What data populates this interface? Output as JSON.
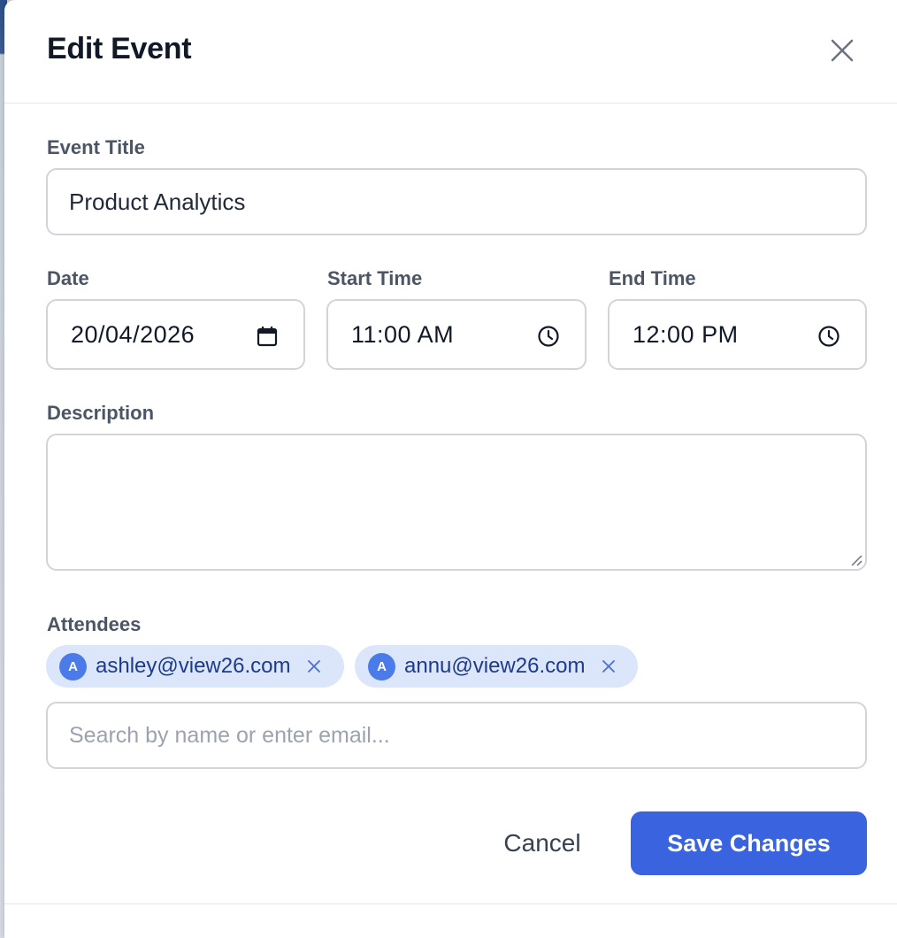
{
  "modal": {
    "title": "Edit Event",
    "close_icon": "close-icon"
  },
  "form": {
    "event_title": {
      "label": "Event Title",
      "value": "Product Analytics"
    },
    "date": {
      "label": "Date",
      "value": "20/04/2026",
      "icon": "calendar-icon"
    },
    "start_time": {
      "label": "Start Time",
      "value": "11:00 AM",
      "icon": "clock-icon"
    },
    "end_time": {
      "label": "End Time",
      "value": "12:00 PM",
      "icon": "clock-icon"
    },
    "description": {
      "label": "Description",
      "value": ""
    },
    "attendees": {
      "label": "Attendees",
      "items": [
        {
          "initial": "A",
          "email": "ashley@view26.com"
        },
        {
          "initial": "A",
          "email": "annu@view26.com"
        }
      ],
      "search_placeholder": "Search by name or enter email..."
    }
  },
  "actions": {
    "cancel_label": "Cancel",
    "save_label": "Save Changes"
  },
  "colors": {
    "primary": "#3a63e0",
    "chip_background": "#dbe6fb",
    "avatar": "#4b7be8",
    "border": "#d1d5db"
  }
}
